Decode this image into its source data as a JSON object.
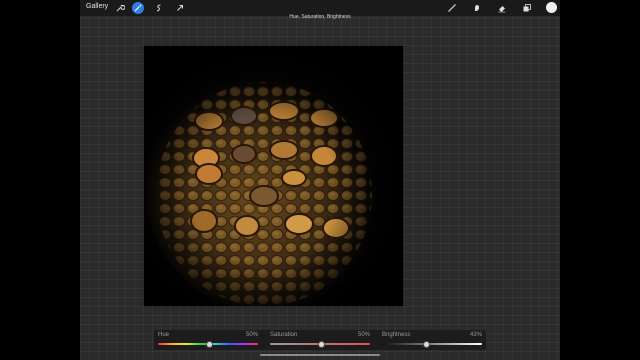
{
  "topbar": {
    "gallery_label": "Gallery",
    "title": "Hue, Saturation, Brightness",
    "left_tools": [
      {
        "name": "wrench-icon",
        "active": false
      },
      {
        "name": "magic-wand-icon",
        "active": true
      },
      {
        "name": "selection-icon",
        "active": false
      },
      {
        "name": "transform-arrow-icon",
        "active": false
      }
    ],
    "right_tools": [
      "brush-icon",
      "smudge-icon",
      "eraser-icon",
      "layers-icon"
    ],
    "active_color": "#f2f2f2",
    "accent_color": "#2f7de1"
  },
  "adjustments": [
    {
      "label": "Hue",
      "value": "50%",
      "fraction": 0.5
    },
    {
      "label": "Saturation",
      "value": "50%",
      "fraction": 0.5
    },
    {
      "label": "Brightness",
      "value": "43%",
      "fraction": 0.43
    }
  ]
}
